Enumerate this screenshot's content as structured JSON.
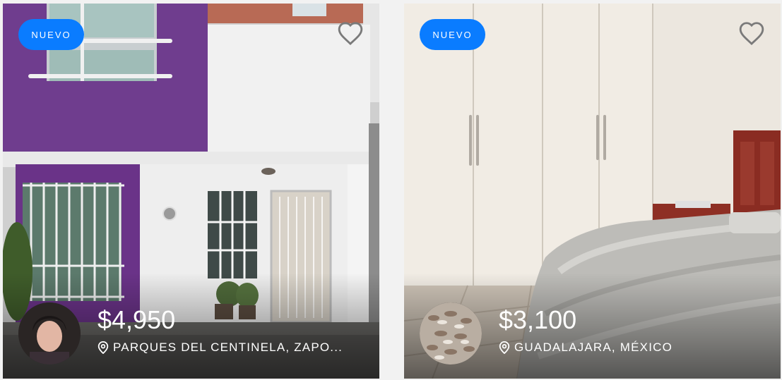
{
  "listings": [
    {
      "badge": "NUEVO",
      "price": "$4,950",
      "location": "PARQUES DEL CENTINELA, ZAPO...",
      "favorite_icon": "heart-outline-icon",
      "location_icon": "map-pin-icon",
      "badge_color": "#0a7cff"
    },
    {
      "badge": "NUEVO",
      "price": "$3,100",
      "location": "GUADALAJARA, MÉXICO",
      "favorite_icon": "heart-outline-icon",
      "location_icon": "map-pin-icon",
      "badge_color": "#0a7cff"
    }
  ]
}
